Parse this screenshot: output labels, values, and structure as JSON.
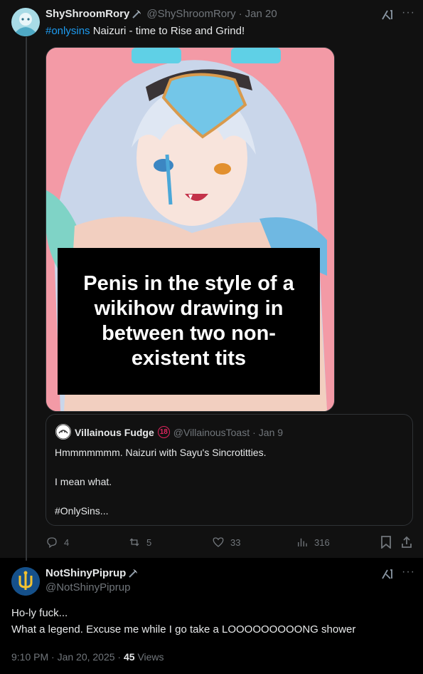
{
  "tweet1": {
    "display_name": "ShyShroomRory",
    "badge_icon": "pickaxe-emoji",
    "handle": "@ShyShroomRory",
    "dot": "·",
    "date": "Jan 20",
    "hashtag": "#onlysins",
    "text": " Naizuri - time to Rise and Grind!",
    "image_caption": "Penis in the style of a wikihow drawing in between two non-existent tits",
    "quote": {
      "display_name": "Villainous Fudge",
      "age_badge": "18",
      "handle": "@VillainousToast",
      "dot": "·",
      "date": "Jan 9",
      "line1": "Hmmmmmmm. Naizuri with Sayu's Sincrotitties.",
      "line2": "I mean what.",
      "line3": "#OnlySins..."
    },
    "actions": {
      "replies": "4",
      "reposts": "5",
      "likes": "33",
      "views": "316"
    }
  },
  "tweet2": {
    "display_name": "NotShinyPiprup",
    "badge_icon": "pickaxe-emoji",
    "handle": "@NotShinyPiprup",
    "line1": "Ho-ly fuck...",
    "line2": "What a legend. Excuse me while I go take a LOOOOOOOOONG shower",
    "time": "9:10 PM · Jan 20, 2025 · ",
    "views_count": "45",
    "views_label": " Views"
  },
  "colors": {
    "link": "#1d9bf0",
    "muted": "#71767b",
    "text": "#e7e9ea",
    "background": "#000000"
  }
}
